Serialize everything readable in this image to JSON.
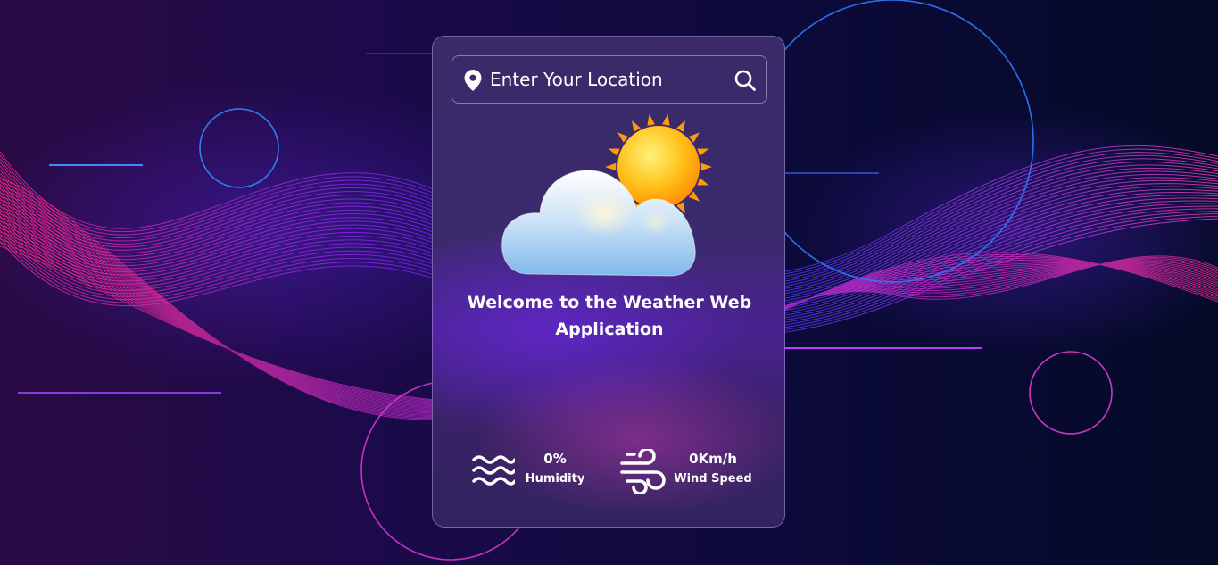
{
  "search": {
    "placeholder": "Enter Your Location",
    "value": ""
  },
  "icons": {
    "location": "map-pin-icon",
    "search": "search-icon",
    "weather": "partly-cloudy-icon",
    "humidity": "waves-icon",
    "wind": "wind-icon"
  },
  "welcome": {
    "line1": "Welcome to the Weather Web",
    "line2": "Application"
  },
  "stats": {
    "humidity": {
      "value": "0%",
      "label": "Humidity"
    },
    "wind": {
      "value": "0Km/h",
      "label": "Wind Speed"
    }
  },
  "colors": {
    "card_border": "#b8aee0",
    "text": "#ffffff",
    "accent_pink": "#ff2fa8",
    "accent_blue": "#2f7bff"
  }
}
